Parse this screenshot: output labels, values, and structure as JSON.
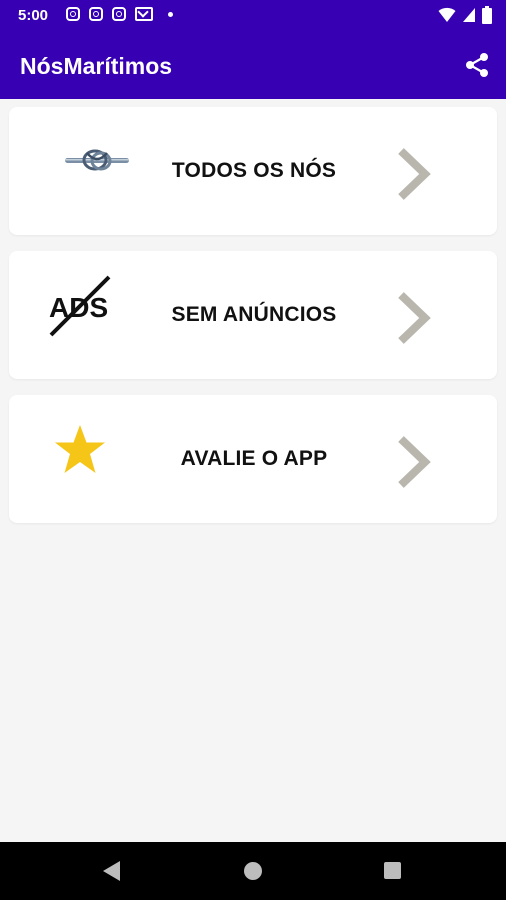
{
  "status_bar": {
    "time": "5:00",
    "left_icons": [
      "instagram-icon",
      "instagram-icon",
      "instagram-icon",
      "mail-icon",
      "dot-icon"
    ],
    "right_icons": [
      "wifi-icon",
      "signal-icon",
      "battery-icon"
    ]
  },
  "app_bar": {
    "title": "NósMarítimos",
    "action_icon": "share-icon",
    "color": "#3700b3"
  },
  "menu": {
    "items": [
      {
        "label": "TODOS OS NÓS",
        "icon": "knot-icon"
      },
      {
        "label": "SEM ANÚNCIOS",
        "icon": "no-ads-icon",
        "icon_text": "ADS"
      },
      {
        "label": "AVALIE O APP",
        "icon": "star-icon"
      }
    ],
    "chevron_color": "#b9b6ad",
    "star_color": "#f5c518"
  },
  "nav_bar": {
    "buttons": [
      "back-icon",
      "home-icon",
      "recents-icon"
    ]
  }
}
